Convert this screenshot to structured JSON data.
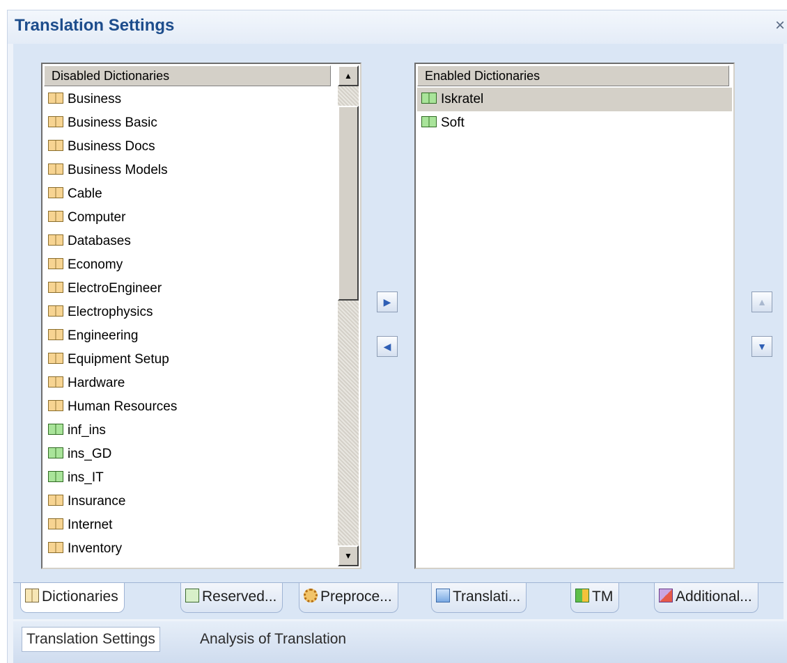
{
  "window": {
    "title": "Translation Settings",
    "close_glyph": "×"
  },
  "disabled_list": {
    "header": "Disabled Dictionaries",
    "items": [
      {
        "label": "Business",
        "icon": "orange"
      },
      {
        "label": "Business Basic",
        "icon": "orange"
      },
      {
        "label": "Business Docs",
        "icon": "orange"
      },
      {
        "label": "Business Models",
        "icon": "orange"
      },
      {
        "label": "Cable",
        "icon": "orange"
      },
      {
        "label": "Computer",
        "icon": "orange"
      },
      {
        "label": "Databases",
        "icon": "orange"
      },
      {
        "label": "Economy",
        "icon": "orange"
      },
      {
        "label": "ElectroEngineer",
        "icon": "orange"
      },
      {
        "label": "Electrophysics",
        "icon": "orange"
      },
      {
        "label": "Engineering",
        "icon": "orange"
      },
      {
        "label": "Equipment Setup",
        "icon": "orange"
      },
      {
        "label": "Hardware",
        "icon": "orange"
      },
      {
        "label": "Human Resources",
        "icon": "orange"
      },
      {
        "label": "inf_ins",
        "icon": "green"
      },
      {
        "label": "ins_GD",
        "icon": "green"
      },
      {
        "label": "ins_IT",
        "icon": "green"
      },
      {
        "label": "Insurance",
        "icon": "orange"
      },
      {
        "label": "Internet",
        "icon": "orange"
      },
      {
        "label": "Inventory",
        "icon": "orange"
      }
    ]
  },
  "enabled_list": {
    "header": "Enabled Dictionaries",
    "items": [
      {
        "label": "Iskratel",
        "icon": "green",
        "selected": true
      },
      {
        "label": "Soft",
        "icon": "green",
        "selected": false
      }
    ]
  },
  "move_buttons": {
    "enable_glyph": "▶",
    "disable_glyph": "◀",
    "up_glyph": "▲",
    "down_glyph": "▼"
  },
  "scrollbar": {
    "up_glyph": "▲",
    "down_glyph": "▼"
  },
  "tabs": [
    {
      "label": "Dictionaries",
      "icon": "book",
      "active": true
    },
    {
      "label": "Reserved...",
      "icon": "check"
    },
    {
      "label": "Preproce...",
      "icon": "gear"
    },
    {
      "label": "Translati...",
      "icon": "screen"
    },
    {
      "label": "TM",
      "icon": "tm"
    },
    {
      "label": "Additional...",
      "icon": "tools"
    }
  ],
  "bottom_tabs": [
    {
      "label": "Translation Settings",
      "active": true
    },
    {
      "label": "Analysis of Translation",
      "active": false
    }
  ]
}
